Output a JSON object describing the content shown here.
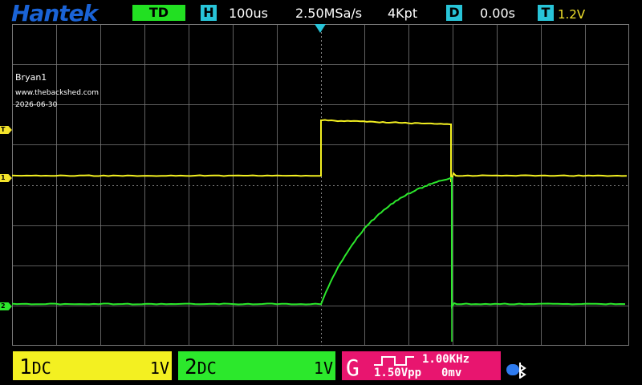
{
  "header": {
    "brand": "Hantek",
    "trigger_mode": "TD",
    "timebase_icon": "H",
    "timebase": "100us",
    "sample_rate": "2.50MSa/s",
    "memory_depth": "4Kpt",
    "delay_icon": "D",
    "delay": "0.00s",
    "trigger_icon": "T",
    "trigger_level": "1.2V"
  },
  "screen": {
    "label_name": "Bryan1",
    "label_site": "www.thebackshed.com",
    "label_date": "2026-06-30",
    "markers": {
      "trigger": "T",
      "ch1": "1",
      "ch2": "2"
    }
  },
  "channels": [
    {
      "name": "1",
      "coupling": "DC",
      "scale": "1V",
      "color": "#f3f021"
    },
    {
      "name": "2",
      "coupling": "DC",
      "scale": "1V",
      "color": "#2ce82c"
    }
  ],
  "generator": {
    "letter": "G",
    "waveform": "square-wave-icon",
    "frequency": "1.00KHz",
    "amplitude": "1.50Vpp",
    "offset": "0mv",
    "color": "#e8156f"
  },
  "status": {
    "bluetooth_icon": "bluetooth-icon"
  },
  "colors": {
    "grid": "#7a7a7a",
    "brand": "#1a63d6",
    "info_box": "#28c4d8",
    "trigger_text": "#f3e32b",
    "ch1_trace": "#f3f021",
    "ch2_trace": "#2ce82c"
  }
}
